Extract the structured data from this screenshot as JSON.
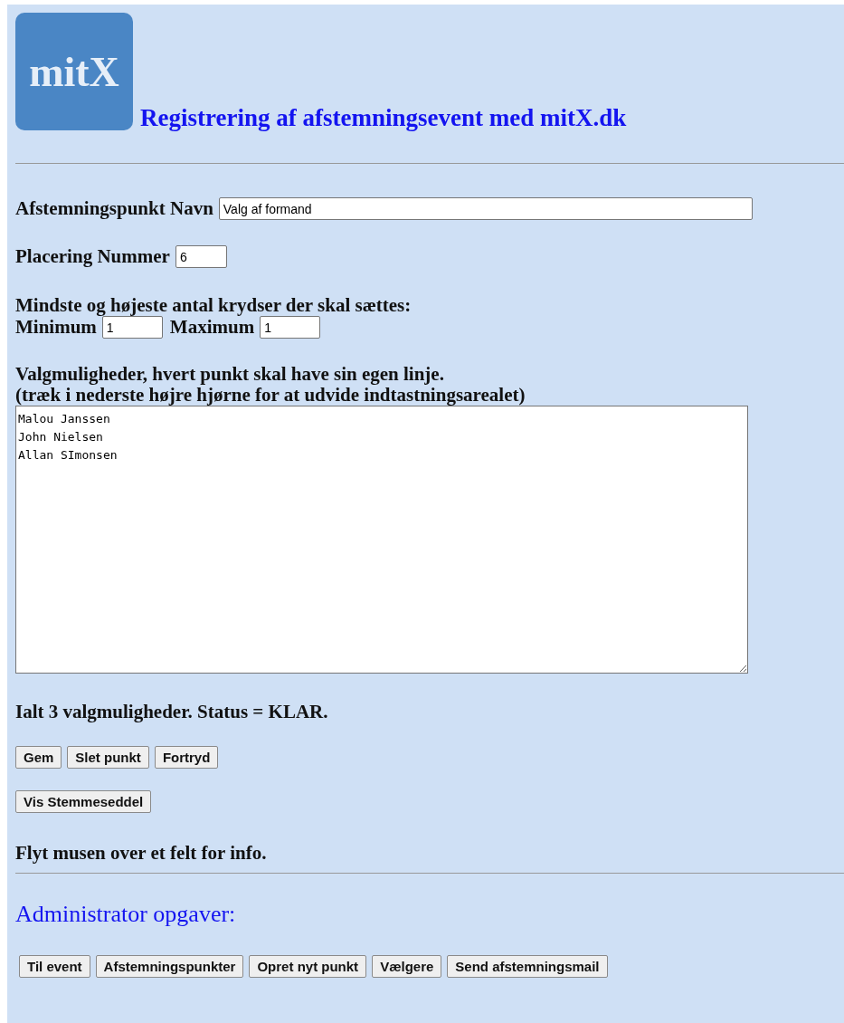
{
  "logo": {
    "text": "mitX"
  },
  "title": "Registrering af afstemningsevent med mitX.dk",
  "name_field": {
    "label": "Afstemningspunkt Navn",
    "value": "Valg af formand"
  },
  "position_field": {
    "label": "Placering Nummer",
    "value": "6"
  },
  "range": {
    "heading": "Mindste og højeste antal krydser der skal sættes:",
    "min_label": "Minimum",
    "min_value": "1",
    "max_label": "Maximum",
    "max_value": "1"
  },
  "options": {
    "heading": "Valgmuligheder, hvert punkt skal have sin egen linje.",
    "hint": "(træk i nederste højre hjørne for at udvide indtastningsarealet)",
    "value": "Malou Janssen\nJohn Nielsen\nAllan SImonsen"
  },
  "summary": "Ialt 3 valgmuligheder. Status = KLAR.",
  "buttons": [
    "Gem",
    "Slet punkt",
    "Fortryd"
  ],
  "ballot_button": "Vis Stemmeseddel",
  "info": "Flyt musen over et felt for info.",
  "admin": {
    "heading": "Administrator opgaver:",
    "buttons": [
      "Til event",
      "Afstemningspunkter",
      "Opret nyt punkt",
      "Vælgere",
      "Send afstemningsmail"
    ]
  }
}
